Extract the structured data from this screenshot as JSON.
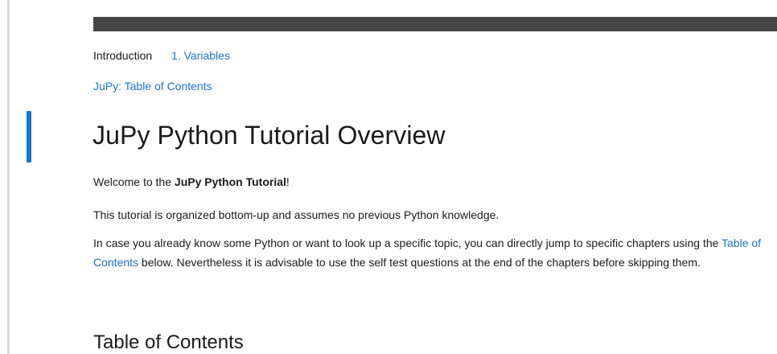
{
  "nav": {
    "introduction": "Introduction",
    "variables": "1. Variables"
  },
  "toc_link": "JuPy: Table of Contents",
  "title": "JuPy Python Tutorial Overview",
  "welcome": {
    "prefix": "Welcome to the ",
    "bold": "JuPy Python Tutorial",
    "suffix": "!"
  },
  "para2": "This tutorial is organized bottom-up and assumes no previous Python knowledge.",
  "para3": {
    "before": "In case you already know some Python or want to look up a specific topic, you can directly jump to specific chapters using the ",
    "link": "Table of Contents",
    "after": " below. Nevertheless it is advisable to use the self test questions at the end of the chapters before skipping them."
  },
  "heading2": "Table of Contents",
  "colors": {
    "link": "#1a73c8",
    "cell_marker": "#1976d2",
    "top_bar": "#454545"
  }
}
